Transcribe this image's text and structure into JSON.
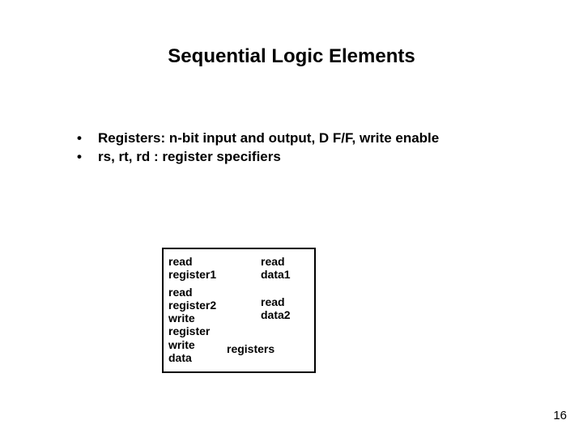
{
  "title": "Sequential Logic Elements",
  "bullets": [
    "Registers: n-bit input and output, D F/F, write enable",
    "rs, rt, rd : register specifiers"
  ],
  "diagram": {
    "read_register1": "read\nregister1",
    "read_register2": "read\nregister2",
    "write_register": "write\nregister",
    "write_data": "write\ndata",
    "read_data1": "read\ndata1",
    "read_data2": "read\ndata2",
    "registers": "registers"
  },
  "page_number": "16",
  "bullet_glyph": "•"
}
